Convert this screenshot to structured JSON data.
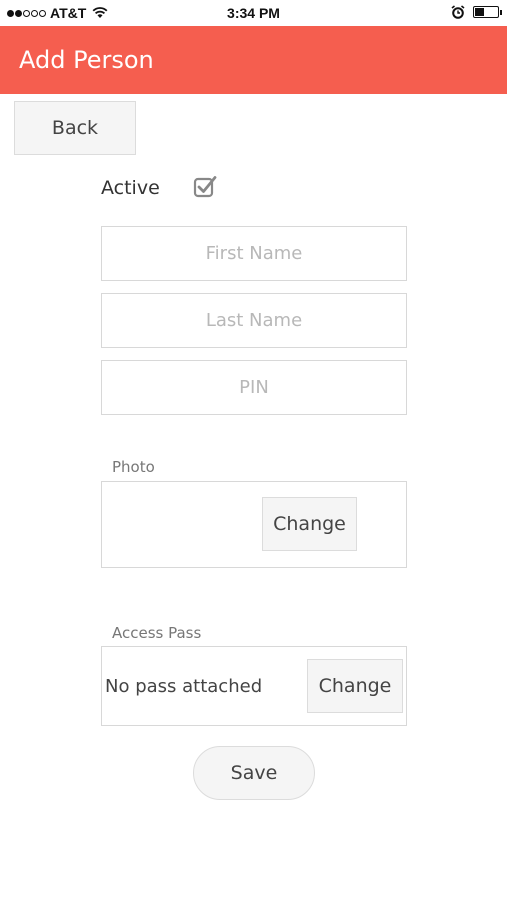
{
  "status_bar": {
    "carrier": "AT&T",
    "time": "3:34 PM",
    "signal_strength_of_5": 2,
    "battery_level": 0.45,
    "icons": [
      "signal-dots-icon",
      "wifi-icon",
      "alarm-icon",
      "battery-icon"
    ]
  },
  "header": {
    "title": "Add Person",
    "background_color": "#f55e4f"
  },
  "back_button": {
    "label": "Back"
  },
  "active": {
    "label": "Active",
    "checked": true
  },
  "fields": {
    "first_name": {
      "placeholder": "First Name",
      "value": ""
    },
    "last_name": {
      "placeholder": "Last Name",
      "value": ""
    },
    "pin": {
      "placeholder": "PIN",
      "value": ""
    }
  },
  "photo": {
    "label": "Photo",
    "change_label": "Change"
  },
  "access_pass": {
    "label": "Access Pass",
    "status_text": "No pass attached",
    "change_label": "Change"
  },
  "save_button": {
    "label": "Save"
  }
}
